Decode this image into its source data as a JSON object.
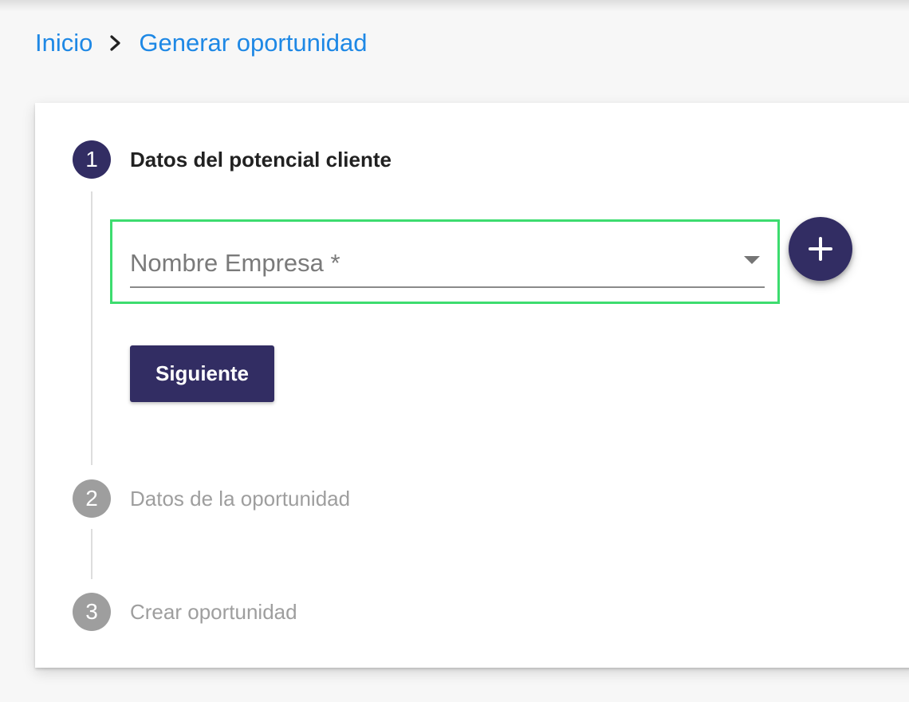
{
  "breadcrumb": {
    "items": [
      {
        "label": "Inicio"
      },
      {
        "label": "Generar oportunidad"
      }
    ],
    "separator_icon": "chevron-right-icon"
  },
  "stepper": {
    "steps": [
      {
        "number": "1",
        "label": "Datos del potencial cliente",
        "state": "active"
      },
      {
        "number": "2",
        "label": "Datos de la oportunidad",
        "state": "inactive"
      },
      {
        "number": "3",
        "label": "Crear oportunidad",
        "state": "inactive"
      }
    ]
  },
  "form": {
    "company_field": {
      "label": "Nombre Empresa *",
      "value": "",
      "dropdown_icon": "caret-down-icon"
    },
    "add_button_icon": "plus-icon",
    "next_button_label": "Siguiente"
  },
  "colors": {
    "primary": "#322d63",
    "link": "#1e88e5",
    "inactive": "#9e9e9e",
    "highlight": "#3ddc6f"
  }
}
